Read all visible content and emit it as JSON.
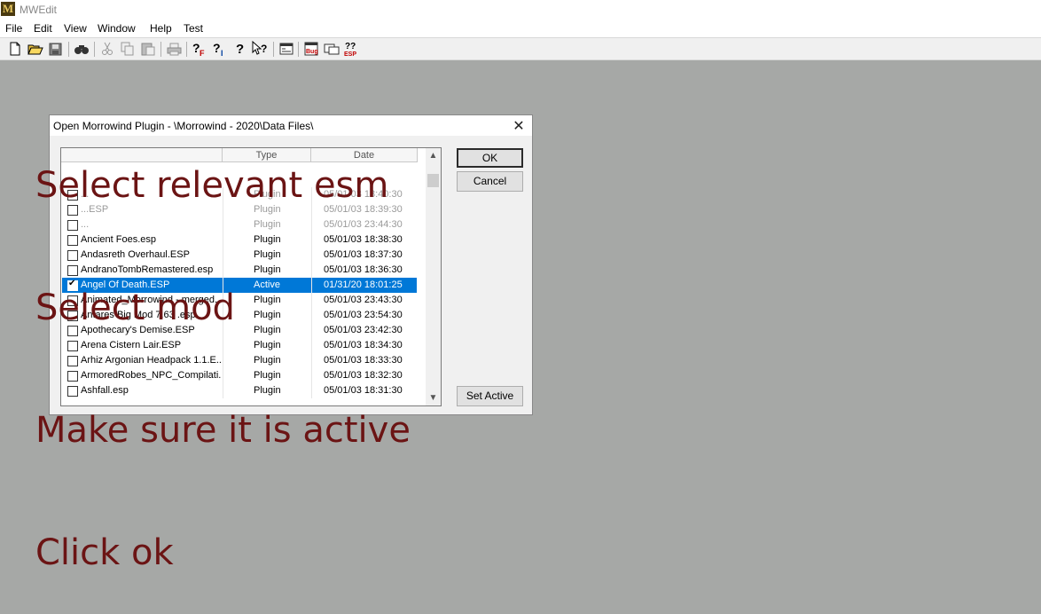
{
  "app": {
    "title": "MWEdit",
    "icon_text": "M"
  },
  "menu": [
    "File",
    "Edit",
    "View",
    "Window",
    "Help",
    "Test"
  ],
  "toolbar": {
    "icons": [
      "new-file-icon",
      "open-folder-icon",
      "save-icon",
      "find-icon",
      "cut-icon",
      "copy-icon",
      "paste-icon",
      "print-icon",
      "help-function-icon",
      "help-index-icon",
      "help-icon",
      "context-help-icon",
      "options-icon",
      "bug-report-icon",
      "window-icon",
      "esp-icon"
    ]
  },
  "dialog": {
    "title": "Open Morrowind Plugin - \\Morrowind - 2020\\Data Files\\",
    "columns": {
      "type": "Type",
      "date": "Date"
    },
    "rows": [
      {
        "name": "...",
        "type": "Plugin",
        "date": "05/01/03 18:40:30",
        "checked": false,
        "selected": false
      },
      {
        "name": "...ESP",
        "type": "Plugin",
        "date": "05/01/03 18:39:30",
        "checked": false,
        "selected": false
      },
      {
        "name": "...",
        "type": "Plugin",
        "date": "05/01/03 23:44:30",
        "checked": false,
        "selected": false
      },
      {
        "name": "Ancient Foes.esp",
        "type": "Plugin",
        "date": "05/01/03 18:38:30",
        "checked": false,
        "selected": false
      },
      {
        "name": "Andasreth Overhaul.ESP",
        "type": "Plugin",
        "date": "05/01/03 18:37:30",
        "checked": false,
        "selected": false
      },
      {
        "name": "AndranoTombRemastered.esp",
        "type": "Plugin",
        "date": "05/01/03 18:36:30",
        "checked": false,
        "selected": false
      },
      {
        "name": "Angel Of Death.ESP",
        "type": "Active",
        "date": "01/31/20 18:01:25",
        "checked": true,
        "selected": true
      },
      {
        "name": "Animated_Morrowind - merged....",
        "type": "Plugin",
        "date": "05/01/03 23:43:30",
        "checked": false,
        "selected": false
      },
      {
        "name": "Antares Big Mod 7.63 .esp",
        "type": "Plugin",
        "date": "05/01/03 23:54:30",
        "checked": false,
        "selected": false
      },
      {
        "name": "Apothecary's Demise.ESP",
        "type": "Plugin",
        "date": "05/01/03 23:42:30",
        "checked": false,
        "selected": false
      },
      {
        "name": "Arena Cistern Lair.ESP",
        "type": "Plugin",
        "date": "05/01/03 18:34:30",
        "checked": false,
        "selected": false
      },
      {
        "name": "Arhiz Argonian Headpack 1.1.E...",
        "type": "Plugin",
        "date": "05/01/03 18:33:30",
        "checked": false,
        "selected": false
      },
      {
        "name": "ArmoredRobes_NPC_Compilati...",
        "type": "Plugin",
        "date": "05/01/03 18:32:30",
        "checked": false,
        "selected": false
      },
      {
        "name": "Ashfall.esp",
        "type": "Plugin",
        "date": "05/01/03 18:31:30",
        "checked": false,
        "selected": false
      }
    ],
    "buttons": {
      "ok": "OK",
      "cancel": "Cancel",
      "set_active": "Set Active"
    }
  },
  "overlay": {
    "lines": [
      "Select relevant esm",
      "Select mod",
      "Make sure it is active",
      "Click ok"
    ],
    "color": "#6b1414"
  }
}
